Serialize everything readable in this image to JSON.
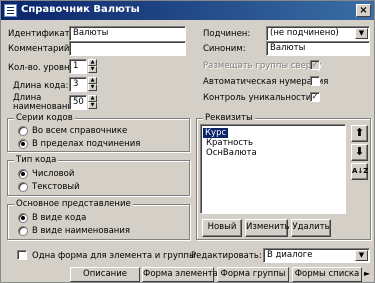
{
  "window": {
    "title": "Справочник Валюты",
    "close_glyph": "×"
  },
  "identifier": {
    "label": "Идентификатор:",
    "value": "Валюты"
  },
  "comment": {
    "label": "Комментарий:",
    "value": ""
  },
  "levels": {
    "label": "Кол-во. уровней:",
    "value": "1"
  },
  "code_length": {
    "label": "Длина кода:",
    "value": "3"
  },
  "name_length": {
    "label_line1": "Длина",
    "label_line2": "наименования:",
    "value": "50"
  },
  "subordinate": {
    "label": "Подчинен:",
    "value": "(не подчинено)"
  },
  "synonym": {
    "label": "Синоним:",
    "value": "Валюты"
  },
  "options": {
    "groups_on_top": {
      "label": "Размещать группы сверху",
      "checked": true,
      "enabled": false
    },
    "auto_number": {
      "label": "Автоматическая нумерация",
      "checked": false
    },
    "unique_control": {
      "label": "Контроль уникальности",
      "checked": true
    }
  },
  "code_series": {
    "title": "Серии кодов",
    "options": [
      "Во всем справочнике",
      "В пределах подчинения"
    ],
    "selected": 1
  },
  "code_type": {
    "title": "Тип кода",
    "options": [
      "Числовой",
      "Текстовый"
    ],
    "selected": 0
  },
  "main_view": {
    "title": "Основное представление",
    "options": [
      "В виде кода",
      "В виде наименования"
    ],
    "selected": 0
  },
  "requisites": {
    "title": "Реквизиты",
    "items": [
      "Курс",
      "Кратность",
      "ОснВалюта"
    ],
    "selected": 0,
    "buttons": {
      "new": "Новый",
      "edit": "Изменить",
      "delete": "Удалить"
    },
    "side_buttons": {
      "up": "⬆",
      "down": "⬇",
      "sort": "A↓Z"
    }
  },
  "one_form": {
    "label": "Одна форма для элемента и группы",
    "checked": false
  },
  "edit_mode": {
    "label": "Редактировать:",
    "value": "В диалоге"
  },
  "tabs": [
    "Описание",
    "Форма элемента",
    "Форма группы",
    "Формы списка"
  ],
  "tab_arrow": "►",
  "colors": {
    "title_bar": "#0a246a",
    "selection": "#0a246a",
    "face": "#d4d0c8"
  }
}
